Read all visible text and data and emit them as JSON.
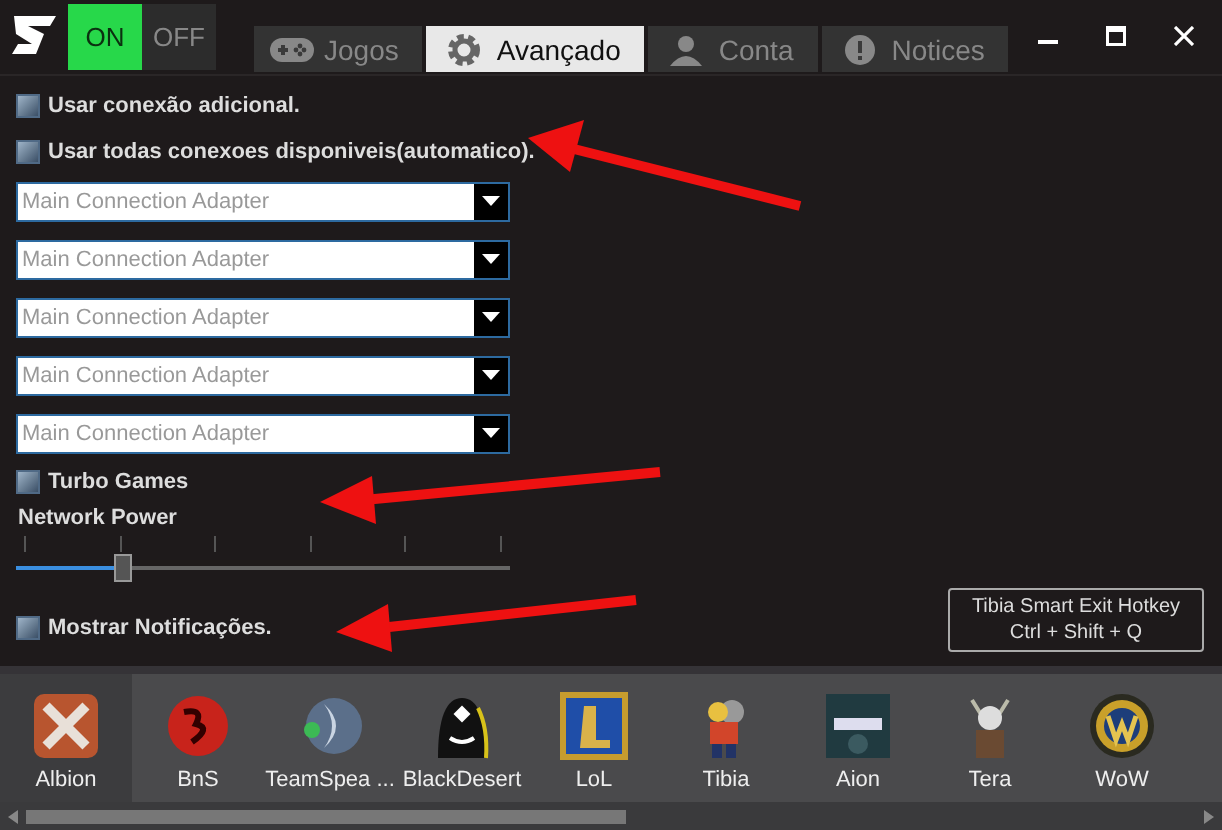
{
  "power_toggle": {
    "on_label": "ON",
    "off_label": "OFF",
    "on": true
  },
  "tabs": [
    {
      "label": "Jogos",
      "selected": false
    },
    {
      "label": "Avançado",
      "selected": true
    },
    {
      "label": "Conta",
      "selected": false
    },
    {
      "label": "Notices",
      "selected": false
    }
  ],
  "options_top": [
    {
      "label": "Usar conexão adicional.",
      "checked": false
    },
    {
      "label": "Usar todas conexoes disponiveis(automatico).",
      "checked": false
    }
  ],
  "adapters": [
    {
      "value": "Main Connection Adapter"
    },
    {
      "value": "Main Connection Adapter"
    },
    {
      "value": "Main Connection Adapter"
    },
    {
      "value": "Main Connection Adapter"
    },
    {
      "value": "Main Connection Adapter"
    }
  ],
  "turbo": {
    "label": "Turbo Games",
    "checked": false
  },
  "network_power": {
    "label": "Network Power",
    "level": 0.22
  },
  "notifications": {
    "label": "Mostrar Notificações.",
    "checked": false
  },
  "hotkey": {
    "line1": "Tibia Smart Exit Hotkey",
    "line2": "Ctrl + Shift + Q"
  },
  "games": [
    {
      "name": "Albion",
      "selected": true
    },
    {
      "name": "BnS",
      "selected": false
    },
    {
      "name": "TeamSpea ...",
      "selected": false
    },
    {
      "name": "BlackDesert",
      "selected": false
    },
    {
      "name": "LoL",
      "selected": false
    },
    {
      "name": "Tibia",
      "selected": false
    },
    {
      "name": "Aion",
      "selected": false
    },
    {
      "name": "Tera",
      "selected": false
    },
    {
      "name": "WoW",
      "selected": false
    }
  ]
}
